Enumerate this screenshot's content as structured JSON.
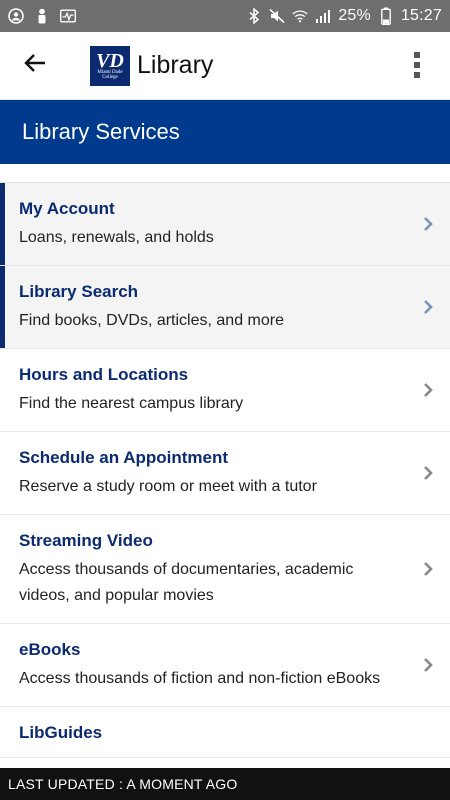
{
  "status_bar": {
    "battery_percent": "25%",
    "time": "15:27",
    "left_icons": [
      "account-circle-icon",
      "person-icon",
      "activity-icon"
    ],
    "right_icons": [
      "bluetooth-icon",
      "mute-icon",
      "wifi-icon",
      "signal-icon",
      "battery-icon"
    ]
  },
  "app_bar": {
    "title": "Library",
    "logo_mark": "VD",
    "logo_subtext": "Miami Dade College",
    "back_icon": "arrow-back-icon",
    "menu_icon": "more-vert-icon"
  },
  "section": {
    "title": "Library Services"
  },
  "items": [
    {
      "title": "My Account",
      "description": "Loans, renewals, and holds"
    },
    {
      "title": "Library Search",
      "description": "Find books, DVDs, articles, and more"
    },
    {
      "title": "Hours and Locations",
      "description": "Find the nearest campus library"
    },
    {
      "title": "Schedule an Appointment",
      "description": "Reserve a study room or meet with a tutor"
    },
    {
      "title": "Streaming Video",
      "description": "Access thousands of documentaries, academic videos, and popular movies"
    },
    {
      "title": "eBooks",
      "description": "Access thousands of fiction and non-fiction eBooks"
    },
    {
      "title": "LibGuides",
      "description": ""
    }
  ],
  "footer": {
    "text": "LAST UPDATED : A MOMENT AGO"
  },
  "colors": {
    "brand_navy": "#0b2a6f",
    "section_blue": "#003a8c",
    "chevron": "#7a93b8",
    "status_bar": "#6e6e6e"
  }
}
